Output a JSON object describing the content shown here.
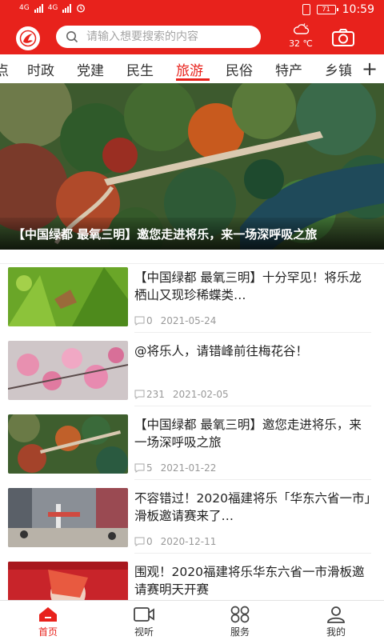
{
  "status_bar": {
    "network_1": "4G",
    "network_2": "4G",
    "battery": "71",
    "time": "10:59"
  },
  "header": {
    "search_placeholder": "请输入想要搜索的内容",
    "weather_icon": "partly-cloudy-icon",
    "temperature": "32 ℃",
    "camera_icon": "camera-icon"
  },
  "tabs": [
    "点",
    "时政",
    "党建",
    "民生",
    "旅游",
    "民俗",
    "特产",
    "乡镇"
  ],
  "active_tab": "旅游",
  "tab_more": "+",
  "banner": {
    "caption": "【中国绿都 最氧三明】邀您走进将乐，来一场深呼吸之旅"
  },
  "articles": [
    {
      "title": "【中国绿都 最氧三明】十分罕见！将乐龙栖山又现珍稀蝶类…",
      "comments": "0",
      "date": "2021-05-24"
    },
    {
      "title": "@将乐人，请错峰前往梅花谷！",
      "comments": "231",
      "date": "2021-02-05"
    },
    {
      "title": "【中国绿都 最氧三明】邀您走进将乐，来一场深呼吸之旅",
      "comments": "5",
      "date": "2021-01-22"
    },
    {
      "title": "不容错过！2020福建将乐「华东六省一市」滑板邀请赛来了…",
      "comments": "0",
      "date": "2020-12-11"
    },
    {
      "title": "围观！2020福建将乐华东六省一市滑板邀请赛明天开赛",
      "comments": "",
      "date": ""
    }
  ],
  "bottom_nav": [
    {
      "label": "首页",
      "icon": "home-icon",
      "active": true
    },
    {
      "label": "视听",
      "icon": "video-icon",
      "active": false
    },
    {
      "label": "服务",
      "icon": "grid-icon",
      "active": false
    },
    {
      "label": "我的",
      "icon": "user-icon",
      "active": false
    }
  ],
  "colors": {
    "brand_red": "#e8221c"
  }
}
